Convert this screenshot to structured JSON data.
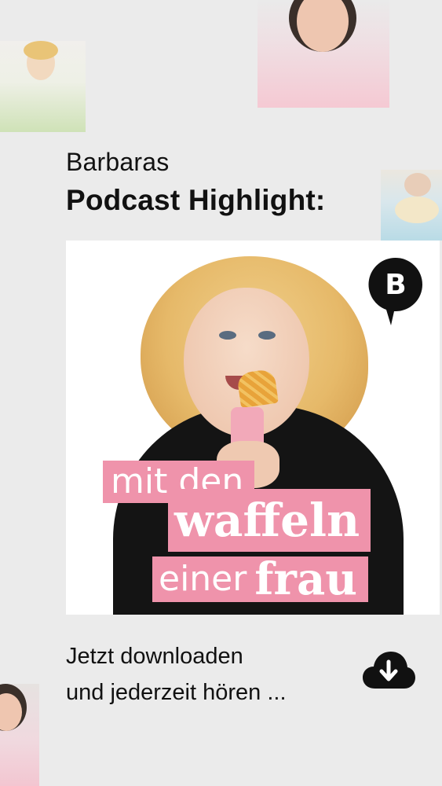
{
  "header": {
    "line1": "Barbaras",
    "line2": "Podcast Highlight:"
  },
  "podcast_cover": {
    "logo_letter": "B",
    "title_line1": "mit den",
    "title_line2": "waffeln",
    "title_line3_light": "einer",
    "title_line3_bold": "frau",
    "accent_color": "#ef93ab"
  },
  "cta": {
    "line1": "Jetzt downloaden",
    "line2": "und jederzeit hören ...",
    "icon": "cloud-download-icon"
  }
}
